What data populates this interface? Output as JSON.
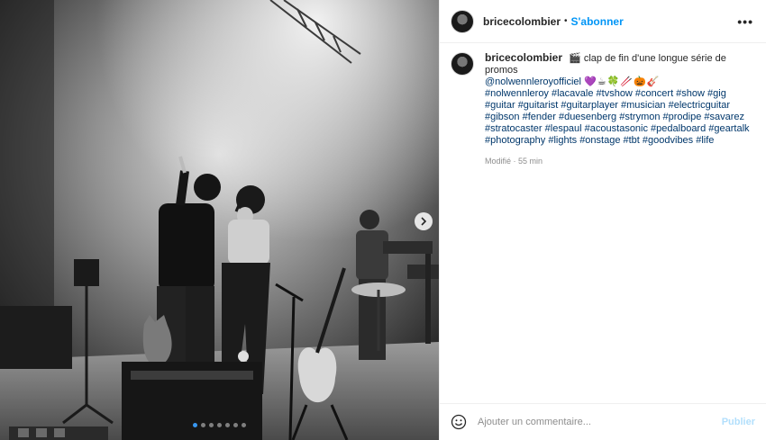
{
  "post": {
    "username": "bricecolombier",
    "separator": "•",
    "follow_label": "S'abonner",
    "more_label": "•••",
    "caption": {
      "username": "bricecolombier",
      "intro": "🎬 clap de fin d'une longue série de promos",
      "mention": "@nolwennleroyofficiel",
      "emojis": "💜☕🍀🥢🎃🎸",
      "hashtags": "#nolwennleroy #lacavale #tvshow #concert #show #gig #guitar #guitarist #guitarplayer #musician #electricguitar #gibson #fender #duesenberg #strymon #prodipe #savarez #stratocaster #lespaul #acoustasonic #pedalboard #geartalk #photography #lights #onstage #tbt #goodvibes #life"
    },
    "meta": "Modifié · 55 min"
  },
  "comment": {
    "placeholder": "Ajouter un commentaire...",
    "publish_label": "Publier"
  },
  "carousel": {
    "next_icon": "chevron-right-icon",
    "total_slides": 7,
    "active_slide": 1
  }
}
